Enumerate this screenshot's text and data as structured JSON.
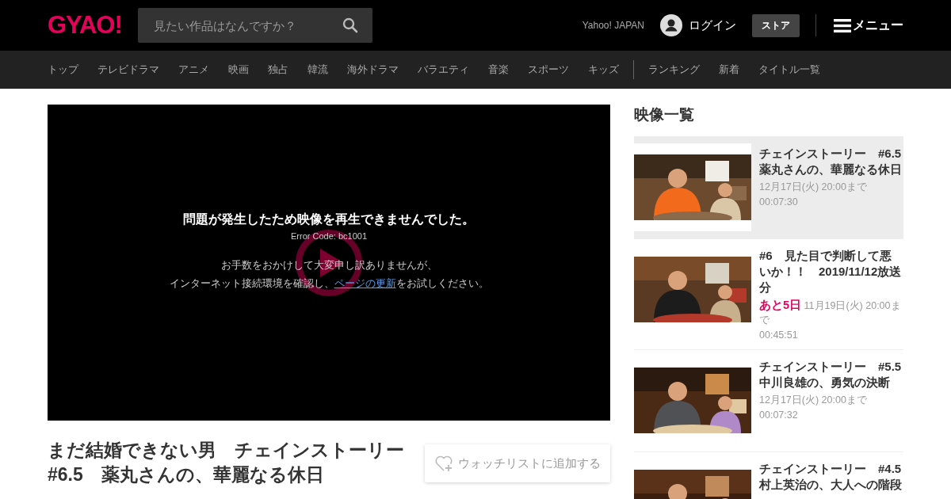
{
  "header": {
    "logo": "GYAO!",
    "search": {
      "placeholder": "見たい作品はなんですか？"
    },
    "yahoo_link": "Yahoo! JAPAN",
    "login": "ログイン",
    "store": "ストア",
    "menu": "メニュー"
  },
  "nav": {
    "groups": [
      {
        "items": [
          "トップ",
          "テレビドラマ",
          "アニメ",
          "映画",
          "独占",
          "韓流",
          "海外ドラマ",
          "バラエティ",
          "音楽",
          "スポーツ",
          "キッズ"
        ]
      },
      {
        "items": [
          "ランキング",
          "新着",
          "タイトル一覧"
        ]
      }
    ]
  },
  "player": {
    "error_title": "問題が発生したため映像を再生できませんでした。",
    "error_code": "Error Code: bc1001",
    "message_line_1": "お手数をおかけして大変申し訳ありませんが、",
    "message_line_2": {
      "before": "インターネット接続環境を確認し、",
      "link": "ページの更新",
      "after": "をお試しください。"
    }
  },
  "title": "まだ結婚できない男　チェインストーリー　#6.5　薬丸さんの、華麗なる休日",
  "watchlist_button": "ウォッチリストに追加する",
  "sidebar": {
    "heading": "映像一覧",
    "items": [
      {
        "title": "チェインストーリー　#6.5　薬丸さんの、華麗なる休日",
        "deadline": "12月17日(火) 20:00まで",
        "duration": "00:07:30",
        "selected": true
      },
      {
        "title": "#6　見た目で判断して悪いか！！　2019/11/12放送分",
        "remaining": "あと5日",
        "deadline": "11月19日(火) 20:00まで",
        "duration": "00:45:51",
        "selected": false
      },
      {
        "title": "チェインストーリー　#5.5　中川良雄の、勇気の決断",
        "deadline": "12月17日(火) 20:00まで",
        "duration": "00:07:32",
        "selected": false
      },
      {
        "title": "チェインストーリー　#4.5　村上英治の、大人への階段",
        "selected": false
      }
    ]
  }
}
